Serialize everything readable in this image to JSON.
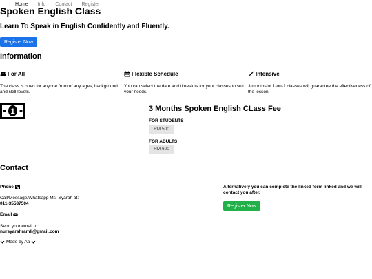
{
  "nav": {
    "items": [
      "Home",
      "Info",
      "Contact",
      "Register"
    ]
  },
  "header": {
    "title": "Spoken English Class",
    "tagline": "Learn To Speak in English Confidently and Fluently.",
    "register_label": "Register Now"
  },
  "information": {
    "heading": "Information",
    "features": [
      {
        "title": "For All",
        "icon": "users-icon",
        "text": "The class is open for anyone from of any ages, background and skill levels."
      },
      {
        "title": "Flexible Schedule",
        "icon": "calendar-icon",
        "text": "You can select the date and timeslots for your classes to suit your needs."
      },
      {
        "title": "Intensive",
        "icon": "compress-icon",
        "text": "3 months of 1-on-1 classes will guarantee the effectiveness of the lesson."
      }
    ]
  },
  "fees": {
    "icon": "money-bill-icon",
    "heading": "3 Months Spoken English CLass Fee",
    "students_label": "FOR STUDENTS",
    "students_price": "RM 500",
    "adults_label": "FOR ADULTS",
    "adults_price": "RM 600"
  },
  "contact": {
    "heading": "Contact",
    "phone_label": "Phone",
    "phone_text": "Call/Message/Whatsapp Ms. Syarah at:",
    "phone_number": "011-35537504",
    "email_label": "Email",
    "email_text": "Send your email to:",
    "email_address": "nursyarahramli@gmail.com",
    "alt_text": "Alternatively you can complete the linked form linked and we will contact you after.",
    "register_label": "Register Now"
  },
  "footer": {
    "text": "Made by Aa"
  }
}
